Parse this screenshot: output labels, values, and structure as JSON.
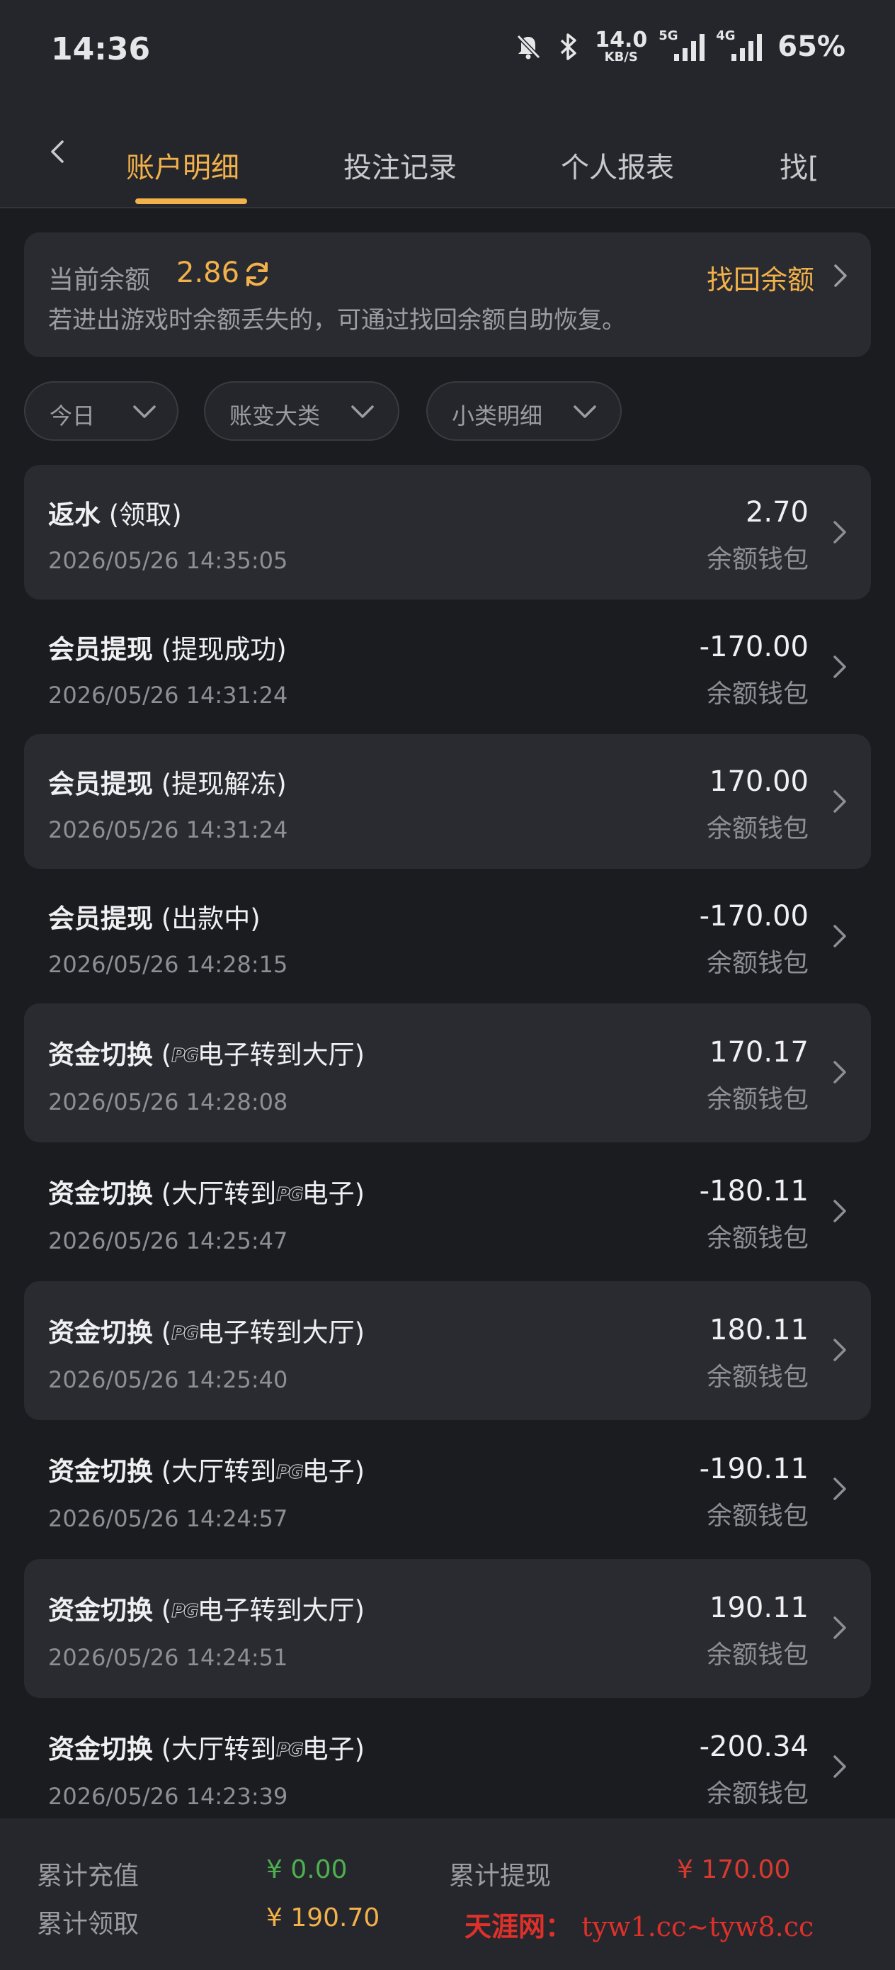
{
  "status_bar": {
    "time": "14:36",
    "net_speed_value": "14.0",
    "net_speed_unit": "KB/S",
    "sig1_tag": "5G",
    "sig2_tag": "4G",
    "battery": "65%"
  },
  "tabs": [
    {
      "label": "账户明细",
      "active": true
    },
    {
      "label": "投注记录",
      "active": false
    },
    {
      "label": "个人报表",
      "active": false
    },
    {
      "label": "找[",
      "active": false
    }
  ],
  "balance": {
    "label": "当前余额",
    "value": "2.86",
    "recover_label": "找回余额",
    "hint": "若进出游戏时余额丢失的，可通过找回余额自助恢复。"
  },
  "filters": [
    {
      "label": "今日"
    },
    {
      "label": "账变大类"
    },
    {
      "label": "小类明细"
    }
  ],
  "transactions": [
    {
      "type": "返水",
      "detail": "(领取)",
      "time": "2026/05/26 14:35:05",
      "amount": "2.70",
      "wallet": "余额钱包"
    },
    {
      "type": "会员提现",
      "detail": "(提现成功)",
      "time": "2026/05/26 14:31:24",
      "amount": "-170.00",
      "wallet": "余额钱包"
    },
    {
      "type": "会员提现",
      "detail": "(提现解冻)",
      "time": "2026/05/26 14:31:24",
      "amount": "170.00",
      "wallet": "余额钱包"
    },
    {
      "type": "会员提现",
      "detail": "(出款中)",
      "time": "2026/05/26 14:28:15",
      "amount": "-170.00",
      "wallet": "余额钱包"
    },
    {
      "type": "资金切换",
      "detail_pre": "(",
      "pg": "PG",
      "detail_post": "电子转到大厅)",
      "time": "2026/05/26 14:28:08",
      "amount": "170.17",
      "wallet": "余额钱包"
    },
    {
      "type": "资金切换",
      "detail_pre": "(大厅转到",
      "pg": "PG",
      "detail_post": "电子)",
      "time": "2026/05/26 14:25:47",
      "amount": "-180.11",
      "wallet": "余额钱包"
    },
    {
      "type": "资金切换",
      "detail_pre": "(",
      "pg": "PG",
      "detail_post": "电子转到大厅)",
      "time": "2026/05/26 14:25:40",
      "amount": "180.11",
      "wallet": "余额钱包"
    },
    {
      "type": "资金切换",
      "detail_pre": "(大厅转到",
      "pg": "PG",
      "detail_post": "电子)",
      "time": "2026/05/26 14:24:57",
      "amount": "-190.11",
      "wallet": "余额钱包"
    },
    {
      "type": "资金切换",
      "detail_pre": "(",
      "pg": "PG",
      "detail_post": "电子转到大厅)",
      "time": "2026/05/26 14:24:51",
      "amount": "190.11",
      "wallet": "余额钱包"
    },
    {
      "type": "资金切换",
      "detail_pre": "(大厅转到",
      "pg": "PG",
      "detail_post": "电子)",
      "time": "2026/05/26 14:23:39",
      "amount": "-200.34",
      "wallet": "余额钱包"
    }
  ],
  "footer": {
    "deposit_label": "累计充值",
    "deposit_value": "¥ 0.00",
    "withdraw_label": "累计提现",
    "withdraw_value": "¥ 170.00",
    "claim_label": "累计领取",
    "claim_value": "¥ 190.70"
  },
  "watermark": {
    "site": "天涯网：",
    "urls": "tyw1.cc~tyw8.cc"
  },
  "colors": {
    "accent": "#f2b14a",
    "background": "#1b1c20",
    "card": "#2a2b30",
    "positive": "#4caf50",
    "negative": "#d63a2f"
  }
}
